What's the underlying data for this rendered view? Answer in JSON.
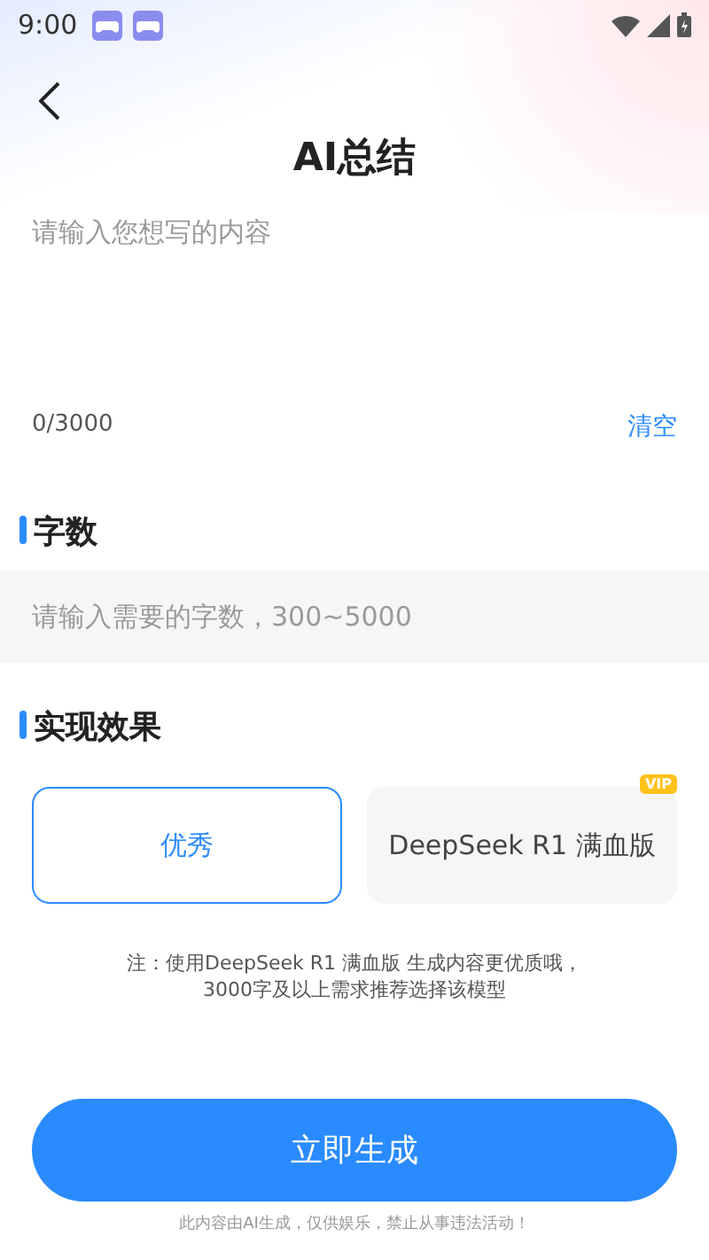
{
  "status_bar": {
    "time": "9:00"
  },
  "header": {
    "title": "AI总结"
  },
  "content_input": {
    "placeholder": "请输入您想写的内容",
    "counter": "0/3000",
    "clear": "清空"
  },
  "word_count": {
    "heading": "字数",
    "placeholder": "请输入需要的字数，300~5000"
  },
  "effect": {
    "heading": "实现效果",
    "options": [
      {
        "label": "优秀",
        "selected": true
      },
      {
        "label": "DeepSeek R1 满血版",
        "selected": false,
        "badge": "VIP"
      }
    ],
    "note": [
      "注：使用DeepSeek R1 满血版 生成内容更优质哦，",
      "3000字及以上需求推荐选择该模型"
    ]
  },
  "generate_button": "立即生成",
  "disclaimer": "此内容由AI生成，仅供娱乐，禁止从事违法活动！"
}
